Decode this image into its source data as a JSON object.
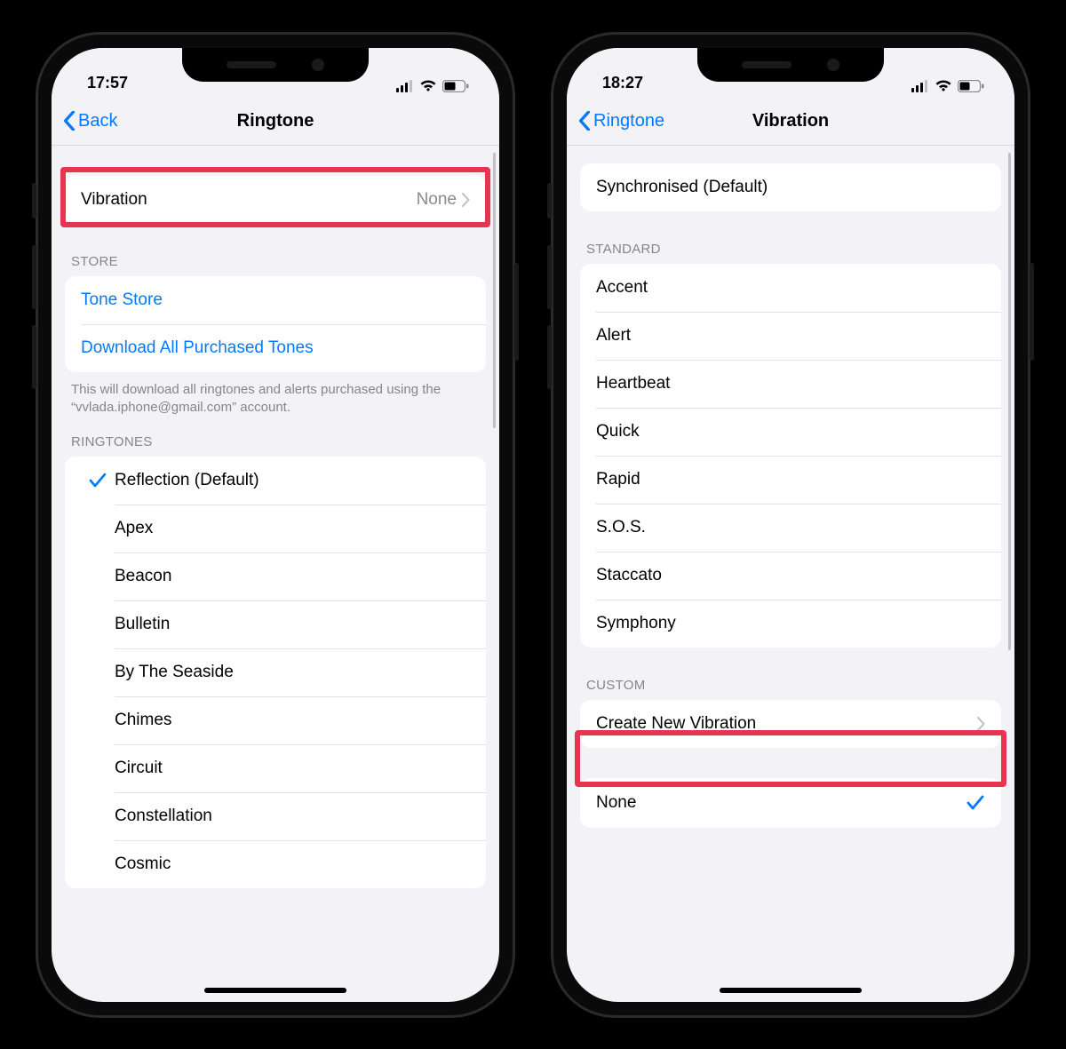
{
  "left": {
    "time": "17:57",
    "nav_back": "Back",
    "nav_title": "Ringtone",
    "vibration_row": {
      "label": "Vibration",
      "value": "None"
    },
    "store_header": "STORE",
    "store_items": [
      {
        "label": "Tone Store"
      },
      {
        "label": "Download All Purchased Tones"
      }
    ],
    "store_footer": "This will download all ringtones and alerts purchased using the “vvlada.iphone@gmail.com” account.",
    "ringtones_header": "RINGTONES",
    "ringtones": [
      {
        "label": "Reflection (Default)",
        "selected": true
      },
      {
        "label": "Apex"
      },
      {
        "label": "Beacon"
      },
      {
        "label": "Bulletin"
      },
      {
        "label": "By The Seaside"
      },
      {
        "label": "Chimes"
      },
      {
        "label": "Circuit"
      },
      {
        "label": "Constellation"
      },
      {
        "label": "Cosmic"
      }
    ]
  },
  "right": {
    "time": "18:27",
    "nav_back": "Ringtone",
    "nav_title": "Vibration",
    "sync_row": {
      "label": "Synchronised (Default)"
    },
    "standard_header": "STANDARD",
    "standard": [
      {
        "label": "Accent"
      },
      {
        "label": "Alert"
      },
      {
        "label": "Heartbeat"
      },
      {
        "label": "Quick"
      },
      {
        "label": "Rapid"
      },
      {
        "label": "S.O.S."
      },
      {
        "label": "Staccato"
      },
      {
        "label": "Symphony"
      }
    ],
    "custom_header": "CUSTOM",
    "create_row": {
      "label": "Create New Vibration"
    },
    "none_row": {
      "label": "None"
    }
  }
}
